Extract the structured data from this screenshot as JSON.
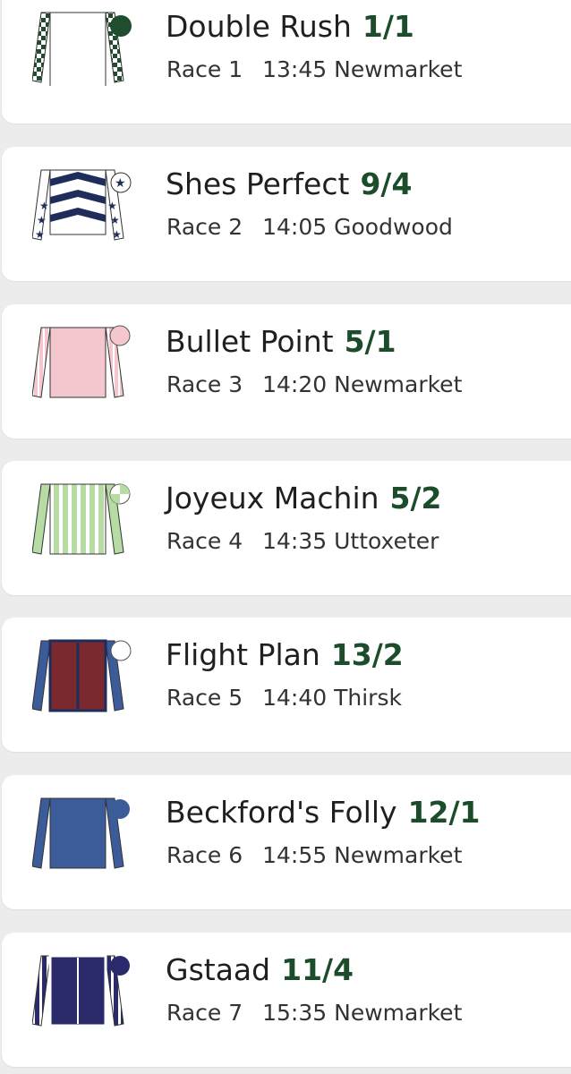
{
  "selections": [
    {
      "horse": "Double Rush",
      "odds": "1/1",
      "race": "Race 1",
      "time_venue": "13:45 Newmarket",
      "silk": "white-body-green-check-sleeves"
    },
    {
      "horse": "Shes Perfect",
      "odds": "9/4",
      "race": "Race 2",
      "time_venue": "14:05 Goodwood",
      "silk": "navy-chevrons-star-sleeves"
    },
    {
      "horse": "Bullet Point",
      "odds": "5/1",
      "race": "Race 3",
      "time_venue": "14:20 Newmarket",
      "silk": "pink-striped-sleeves"
    },
    {
      "horse": "Joyeux Machin",
      "odds": "5/2",
      "race": "Race 4",
      "time_venue": "14:35 Uttoxeter",
      "silk": "green-white-stripes"
    },
    {
      "horse": "Flight Plan",
      "odds": "13/2",
      "race": "Race 5",
      "time_venue": "14:40 Thirsk",
      "silk": "maroon-body-blue-sleeves"
    },
    {
      "horse": "Beckford's Folly",
      "odds": "12/1",
      "race": "Race 6",
      "time_venue": "14:55 Newmarket",
      "silk": "royal-blue"
    },
    {
      "horse": "Gstaad",
      "odds": "11/4",
      "race": "Race 7",
      "time_venue": "15:35 Newmarket",
      "silk": "navy-striped-sleeves"
    }
  ],
  "colors": {
    "odds": "#1b4d2b",
    "background": "#ececec",
    "card": "#ffffff"
  }
}
